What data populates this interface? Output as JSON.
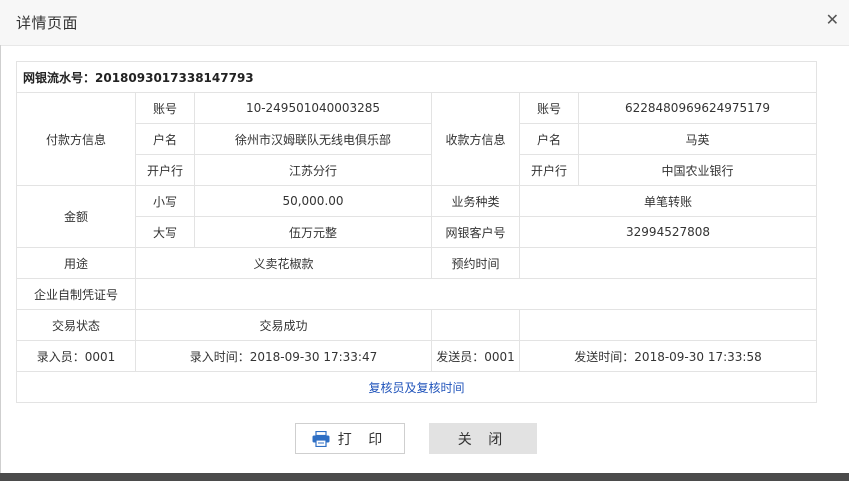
{
  "window": {
    "title": "详情页面"
  },
  "serial": {
    "label": "网银流水号：2018093017338147793"
  },
  "payer": {
    "section": "付款方信息",
    "account_label": "账号",
    "account": "10-249501040003285",
    "name_label": "户名",
    "name": "徐州市汉姆联队无线电俱乐部",
    "bank_label": "开户行",
    "bank": "江苏分行"
  },
  "payee": {
    "section": "收款方信息",
    "account_label": "账号",
    "account": "6228480969624975179",
    "name_label": "户名",
    "name": "马英",
    "bank_label": "开户行",
    "bank": "中国农业银行"
  },
  "amount": {
    "section": "金额",
    "small_label": "小写",
    "small": "50,000.00",
    "big_label": "大写",
    "big": "伍万元整"
  },
  "business": {
    "type_label": "业务种类",
    "type": "单笔转账",
    "client_label": "网银客户号",
    "client": "32994527808"
  },
  "purpose": {
    "label": "用途",
    "value": "义卖花椒款"
  },
  "schedule": {
    "label": "预约时间",
    "value": ""
  },
  "voucher": {
    "label": "企业自制凭证号",
    "value": ""
  },
  "status": {
    "label": "交易状态",
    "value": "交易成功"
  },
  "record": {
    "entry_operator": "录入员：0001",
    "entry_time": "录入时间：2018-09-30 17:33:47",
    "send_operator": "发送员：0001",
    "send_time": "发送时间：2018-09-30 17:33:58"
  },
  "review_link": "复核员及复核时间",
  "buttons": {
    "print": "打 印",
    "close": "关 闭"
  }
}
